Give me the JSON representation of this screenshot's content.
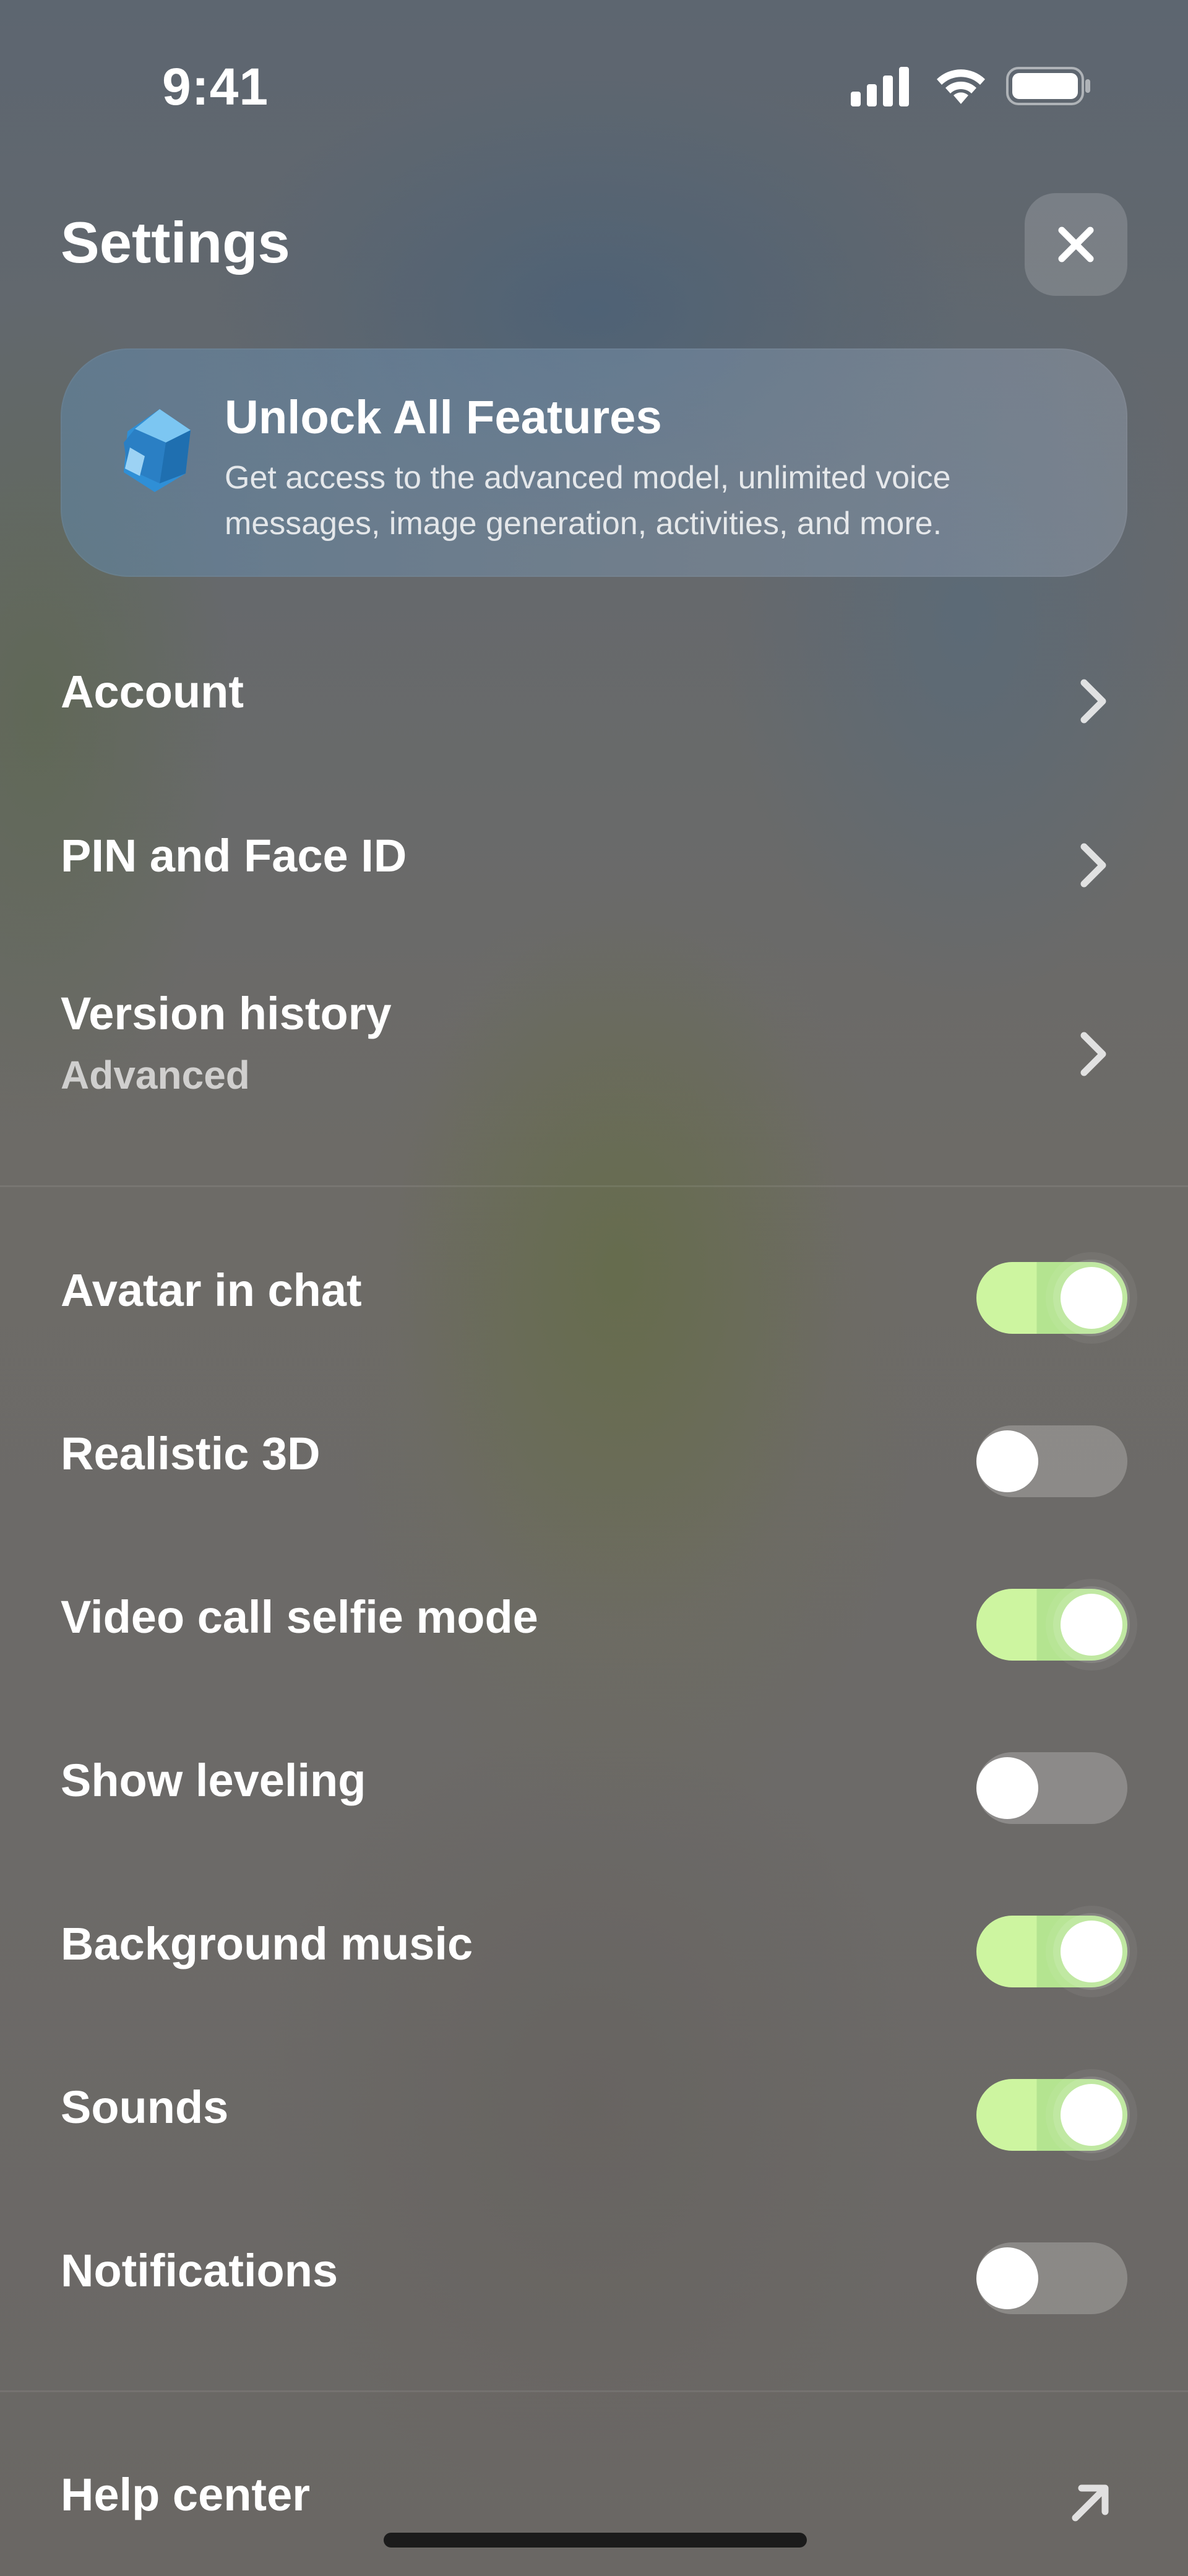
{
  "status_bar": {
    "time": "9:41",
    "icons": [
      "signal-icon",
      "wifi-icon",
      "battery-icon"
    ]
  },
  "header": {
    "title": "Settings",
    "close_icon": "close-icon"
  },
  "promo": {
    "icon": "gem-icon",
    "title": "Unlock All Features",
    "description": "Get access to the advanced model, unlimited voice messages, image generation, activities, and more."
  },
  "nav_items": [
    {
      "label": "Account",
      "icon": "chevron-right-icon"
    },
    {
      "label": "PIN and Face ID",
      "icon": "chevron-right-icon"
    },
    {
      "label": "Version history",
      "sublabel": "Advanced",
      "icon": "chevron-right-icon"
    }
  ],
  "toggles": [
    {
      "label": "Avatar in chat",
      "on": true
    },
    {
      "label": "Realistic 3D",
      "on": false
    },
    {
      "label": "Video call selfie mode",
      "on": true
    },
    {
      "label": "Show leveling",
      "on": false
    },
    {
      "label": "Background music",
      "on": true
    },
    {
      "label": "Sounds",
      "on": true
    },
    {
      "label": "Notifications",
      "on": false
    }
  ],
  "footer_link": {
    "label": "Help center",
    "icon": "arrow-up-right-icon"
  },
  "colors": {
    "toggle_on": "#cdf5a0",
    "toggle_off": "#8e8b88",
    "text": "#ffffff"
  }
}
